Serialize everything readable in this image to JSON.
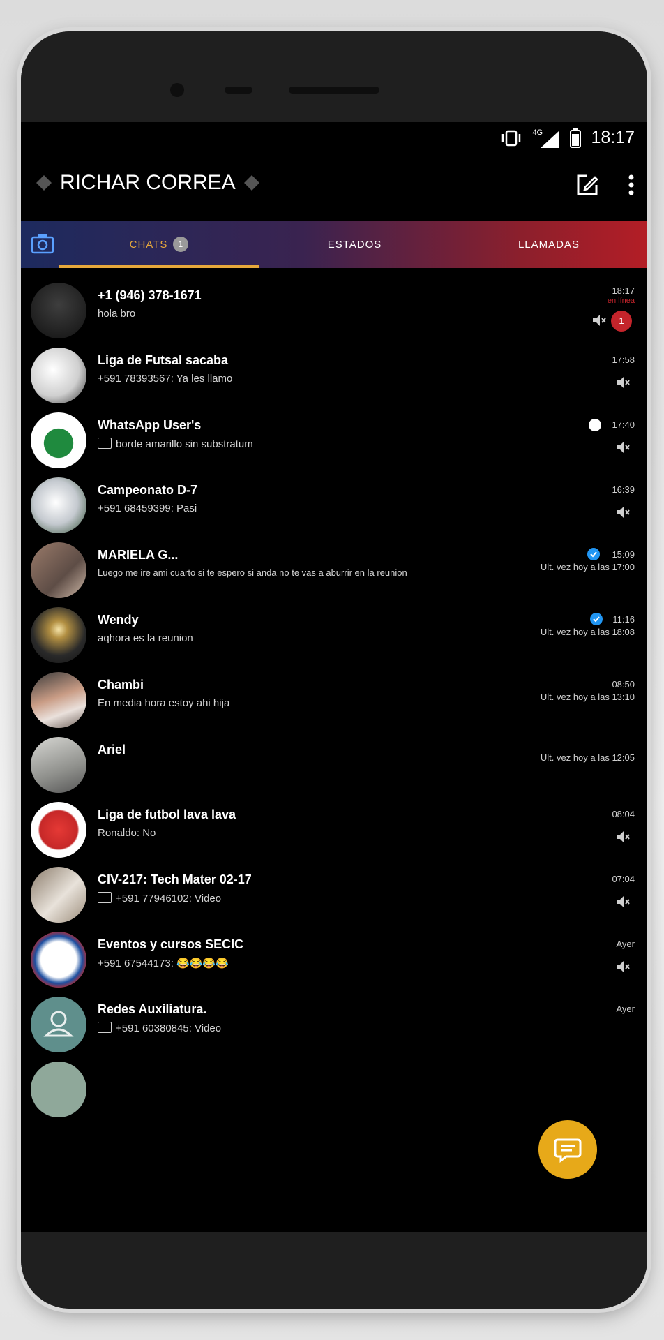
{
  "status_bar": {
    "time": "18:17",
    "network": "4G"
  },
  "app_bar": {
    "title": "RICHAR CORREA"
  },
  "tabs": [
    {
      "label": "CHATS",
      "badge": "1"
    },
    {
      "label": "ESTADOS"
    },
    {
      "label": "LLAMADAS"
    }
  ],
  "chats": [
    {
      "name": "+1 (946) 378-1671",
      "preview": "hola bro",
      "time": "18:17",
      "sub": "en línea",
      "muted": true,
      "unread": "1"
    },
    {
      "name": "Liga de Futsal sacaba",
      "preview": "+591 78393567: Ya les llamo",
      "time": "17:58",
      "muted": true
    },
    {
      "name": "WhatsApp User's",
      "preview": "borde amarillo sin substratum",
      "time": "17:40",
      "muted": true
    },
    {
      "name": "Campeonato D-7",
      "preview": "+591 68459399: Pasi",
      "time": "16:39",
      "muted": true
    },
    {
      "name": "MARIELA G...",
      "preview": "Luego me ire ami cuarto si te espero si anda no te vas a aburrir en la reunion",
      "time": "15:09",
      "sub": "Ult. vez hoy a las 17:00"
    },
    {
      "name": "Wendy",
      "preview": "aqhora es la reunion",
      "time": "11:16",
      "sub": "Ult. vez hoy a las 18:08"
    },
    {
      "name": "Chambi",
      "preview": "En media hora estoy ahi hija",
      "time": "08:50",
      "sub": "Ult. vez hoy a las 13:10"
    },
    {
      "name": "Ariel",
      "preview": "",
      "time": "",
      "sub": "Ult. vez hoy a las 12:05"
    },
    {
      "name": "Liga de futbol lava lava",
      "preview": "Ronaldo: No",
      "time": "08:04",
      "muted": true
    },
    {
      "name": "CIV-217: Tech Mater 02-17",
      "preview": "+591 77946102: Video",
      "time": "07:04",
      "muted": true
    },
    {
      "name": "Eventos y cursos SECIC",
      "preview": "+591 67544173: 😂😂😂😂",
      "time": "Ayer",
      "muted": true
    },
    {
      "name": "Redes Auxiliatura.",
      "preview": "+591 60380845: Video",
      "time": "Ayer"
    }
  ],
  "icons": {
    "back": "back-arrow-icon",
    "compose": "compose-icon",
    "menu": "more-vertical-icon",
    "camera": "camera-icon",
    "fab": "new-chat-icon"
  },
  "colors": {
    "accent": "#e7a83b",
    "unread": "#c4242b",
    "fab": "#e7a919"
  }
}
